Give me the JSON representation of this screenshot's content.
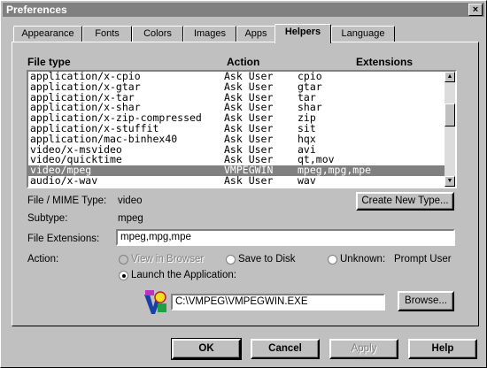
{
  "window": {
    "title": "Preferences"
  },
  "tabs": [
    {
      "label": "Appearance"
    },
    {
      "label": "Fonts"
    },
    {
      "label": "Colors"
    },
    {
      "label": "Images"
    },
    {
      "label": "Apps"
    },
    {
      "label": "Helpers"
    },
    {
      "label": "Language"
    }
  ],
  "active_tab": "Helpers",
  "list": {
    "headers": {
      "file_type": "File type",
      "action": "Action",
      "extensions": "Extensions"
    },
    "rows": [
      {
        "type": "application/x-cpio",
        "action": "Ask User",
        "ext": "cpio"
      },
      {
        "type": "application/x-gtar",
        "action": "Ask User",
        "ext": "gtar"
      },
      {
        "type": "application/x-tar",
        "action": "Ask User",
        "ext": "tar"
      },
      {
        "type": "application/x-shar",
        "action": "Ask User",
        "ext": "shar"
      },
      {
        "type": "application/x-zip-compressed",
        "action": "Ask User",
        "ext": "zip"
      },
      {
        "type": "application/x-stuffit",
        "action": "Ask User",
        "ext": "sit"
      },
      {
        "type": "application/mac-binhex40",
        "action": "Ask User",
        "ext": "hqx"
      },
      {
        "type": "video/x-msvideo",
        "action": "Ask User",
        "ext": "avi"
      },
      {
        "type": "video/quicktime",
        "action": "Ask User",
        "ext": "qt,mov"
      },
      {
        "type": "video/mpeg",
        "action": "VMPEGWIN",
        "ext": "mpeg,mpg,mpe"
      },
      {
        "type": "audio/x-wav",
        "action": "Ask User",
        "ext": "wav"
      }
    ],
    "selected_index": 9
  },
  "details": {
    "mime_label": "File / MIME Type:",
    "mime_value": "video",
    "subtype_label": "Subtype:",
    "subtype_value": "mpeg",
    "extensions_label": "File Extensions:",
    "extensions_value": "mpeg,mpg,mpe",
    "action_label": "Action:",
    "create_button": "Create New Type...",
    "browse_button": "Browse...",
    "app_path": "C:\\VMPEG\\VMPEGWIN.EXE"
  },
  "action_options": {
    "view_in_browser": "View in Browser",
    "save_to_disk": "Save to Disk",
    "unknown": "Unknown:",
    "prompt_user": "Prompt User",
    "launch_app": "Launch the Application:"
  },
  "footer": {
    "ok": "OK",
    "cancel": "Cancel",
    "apply": "Apply",
    "help": "Help"
  },
  "colors": {
    "face": "#c0c0c0",
    "shadow": "#808080",
    "selection": "#808080"
  }
}
